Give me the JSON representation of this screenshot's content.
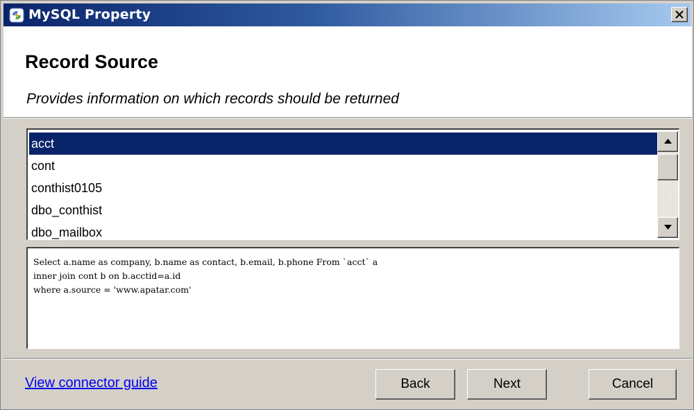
{
  "window": {
    "title": "MySQL Property",
    "title_icon": "mysql-app-icon",
    "close_icon": "close-icon",
    "titlebar_color": "#0a246a"
  },
  "header": {
    "title": "Record Source",
    "subtitle": "Provides information on which records should be returned"
  },
  "tables": {
    "items": [
      {
        "label": "acct",
        "selected": true
      },
      {
        "label": "cont",
        "selected": false
      },
      {
        "label": "conthist0105",
        "selected": false
      },
      {
        "label": "dbo_conthist",
        "selected": false
      },
      {
        "label": "dbo_mailbox",
        "selected": false
      }
    ],
    "selection_color": "#0a246a"
  },
  "query": {
    "lines": [
      "Select a.name as company, b.name as contact, b.email, b.phone From `acct` a",
      "inner join cont b on b.acctid=a.id",
      "where a.source = 'www.apatar.com'"
    ]
  },
  "footer": {
    "guide_link": "View connector guide",
    "back_label": "Back",
    "next_label": "Next",
    "cancel_label": "Cancel",
    "link_color": "#0000ee"
  }
}
